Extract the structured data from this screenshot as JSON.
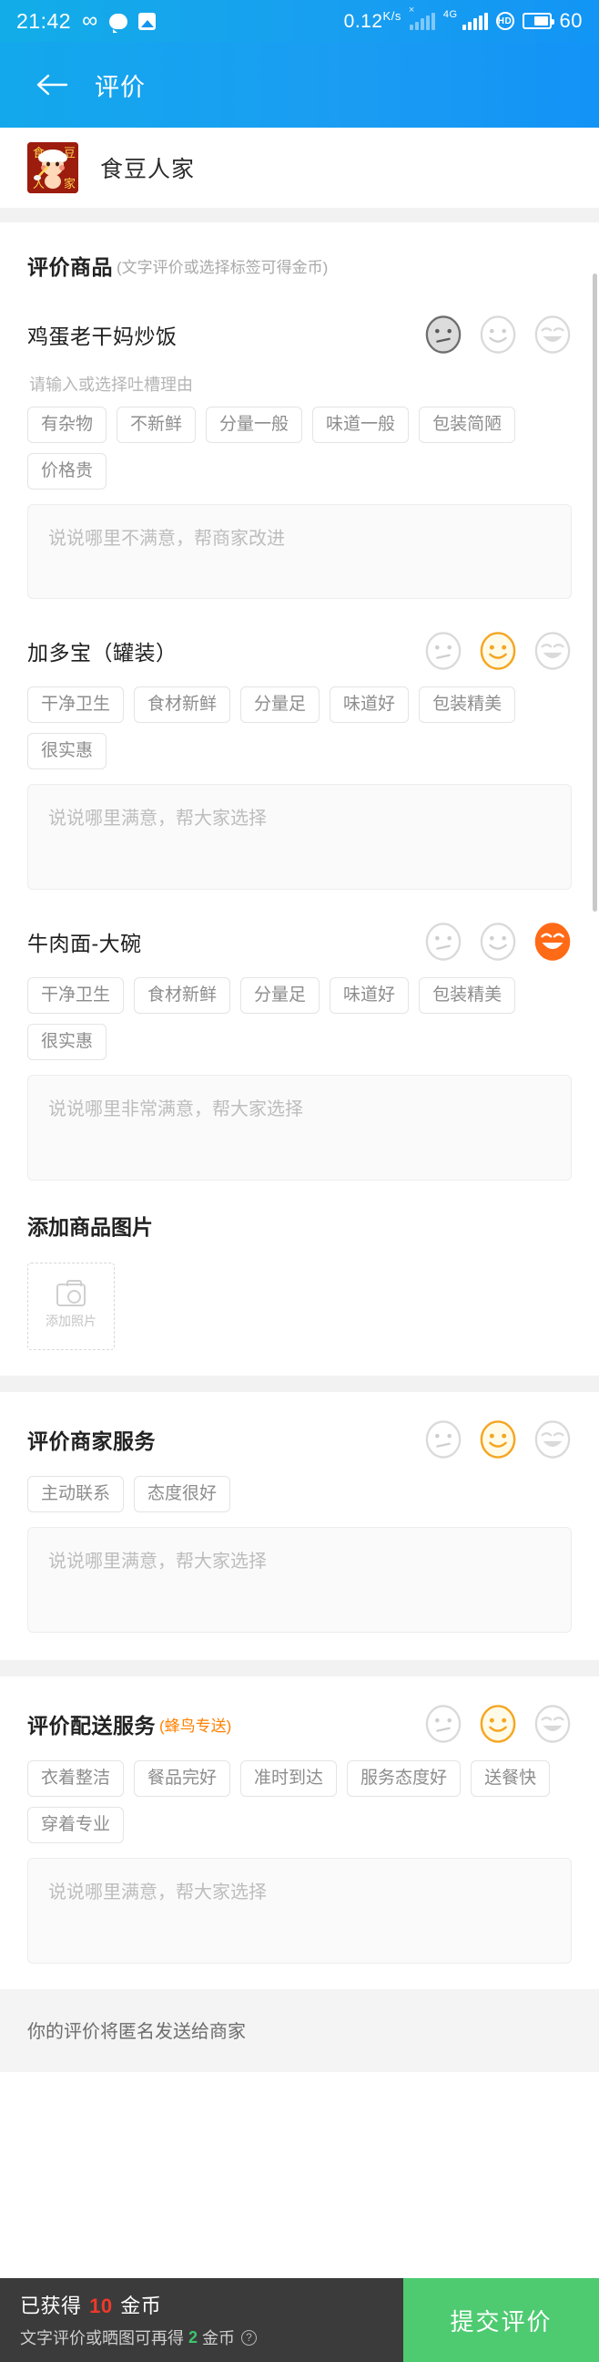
{
  "statusbar": {
    "time": "21:42",
    "icons": [
      "infinity-icon",
      "chat-icon",
      "image-icon"
    ],
    "net_speed": "0.12",
    "net_speed_unit_top": "K",
    "net_speed_unit_bottom": "s",
    "network_label": "4G",
    "voice_label": "HD",
    "battery_level": "60"
  },
  "navbar": {
    "back_icon": "back-arrow-icon",
    "title": "评价"
  },
  "shop": {
    "logo_alt": "食豆人家",
    "name": "食豆人家"
  },
  "product_section": {
    "title": "评价商品",
    "subtitle": "(文字评价或选择标签可得金币)",
    "products": [
      {
        "name": "鸡蛋老干妈炒饭",
        "rating": "bad",
        "hint": "请输入或选择吐槽理由",
        "tags": [
          "有杂物",
          "不新鲜",
          "分量一般",
          "味道一般",
          "包装简陋",
          "价格贵"
        ],
        "comment_value": "",
        "comment_placeholder": "说说哪里不满意，帮商家改进"
      },
      {
        "name": "加多宝（罐装）",
        "rating": "good",
        "hint": "",
        "tags": [
          "干净卫生",
          "食材新鲜",
          "分量足",
          "味道好",
          "包装精美",
          "很实惠"
        ],
        "comment_value": "",
        "comment_placeholder": "说说哪里满意，帮大家选择"
      },
      {
        "name": "牛肉面-大碗",
        "rating": "great",
        "hint": "",
        "tags": [
          "干净卫生",
          "食材新鲜",
          "分量足",
          "味道好",
          "包装精美",
          "很实惠"
        ],
        "comment_value": "",
        "comment_placeholder": "说说哪里非常满意，帮大家选择"
      }
    ]
  },
  "photo_section": {
    "title": "添加商品图片",
    "add_label": "添加照片"
  },
  "merchant_section": {
    "title": "评价商家服务",
    "rating": "good",
    "tags": [
      "主动联系",
      "态度很好"
    ],
    "comment_value": "",
    "comment_placeholder": "说说哪里满意，帮大家选择"
  },
  "delivery_section": {
    "title": "评价配送服务",
    "subtitle": "(蜂鸟专送)",
    "rating": "good",
    "tags": [
      "衣着整洁",
      "餐品完好",
      "准时到达",
      "服务态度好",
      "送餐快",
      "穿着专业"
    ],
    "comment_value": "",
    "comment_placeholder": "说说哪里满意，帮大家选择"
  },
  "anonymous_note": "你的评价将匿名发送给商家",
  "bottombar": {
    "earned_prefix": "已获得",
    "earned_amount": "10",
    "earned_suffix": "金币",
    "more_prefix": "文字评价或晒图可再得",
    "more_amount": "2",
    "more_suffix": "金币",
    "help_icon": "question-mark-icon",
    "submit_label": "提交评价"
  },
  "colors": {
    "brand_blue": "#1296f0",
    "selected_mid": "#f5a623",
    "selected_great": "#ff6b1a",
    "submit_green": "#4ecb71",
    "coin_red": "#f0392b"
  }
}
